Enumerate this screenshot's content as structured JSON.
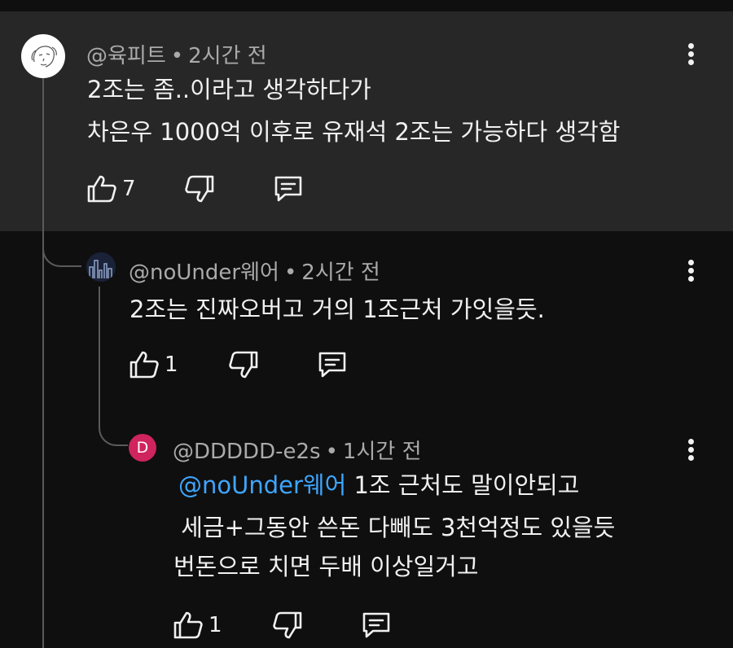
{
  "comments": [
    {
      "author": "@육피트",
      "time": "2시간 전",
      "lines": [
        "2조는 좀..이라고 생각하다가",
        "차은우 1000억 이후로 유재석 2조는 가능하다 생각함"
      ],
      "likes": "7"
    },
    {
      "author": "@noUnder웨어",
      "time": "2시간 전",
      "lines": [
        "2조는 진짜오버고 거의 1조근처 가잇을듯."
      ],
      "likes": "1"
    },
    {
      "author": "@DDDDD-e2s",
      "avatar_letter": "D",
      "time": "1시간 전",
      "mention": "@noUnder웨어",
      "line1_rest": " 1조 근처도 말이안되고",
      "lines": [
        " 세금+그동안 쓴돈 다빼도 3천억정도 있을듯",
        "번돈으로 치면 두배 이상일거고"
      ],
      "likes": "1"
    }
  ],
  "separator": "•",
  "colors": {
    "highlight_bg": "#272727",
    "bg": "#0f0f0f",
    "mention": "#3ea6ff",
    "avatar_d": "#d0245e"
  },
  "icons": [
    "like-icon",
    "dislike-icon",
    "reply-icon",
    "more-options-icon"
  ]
}
